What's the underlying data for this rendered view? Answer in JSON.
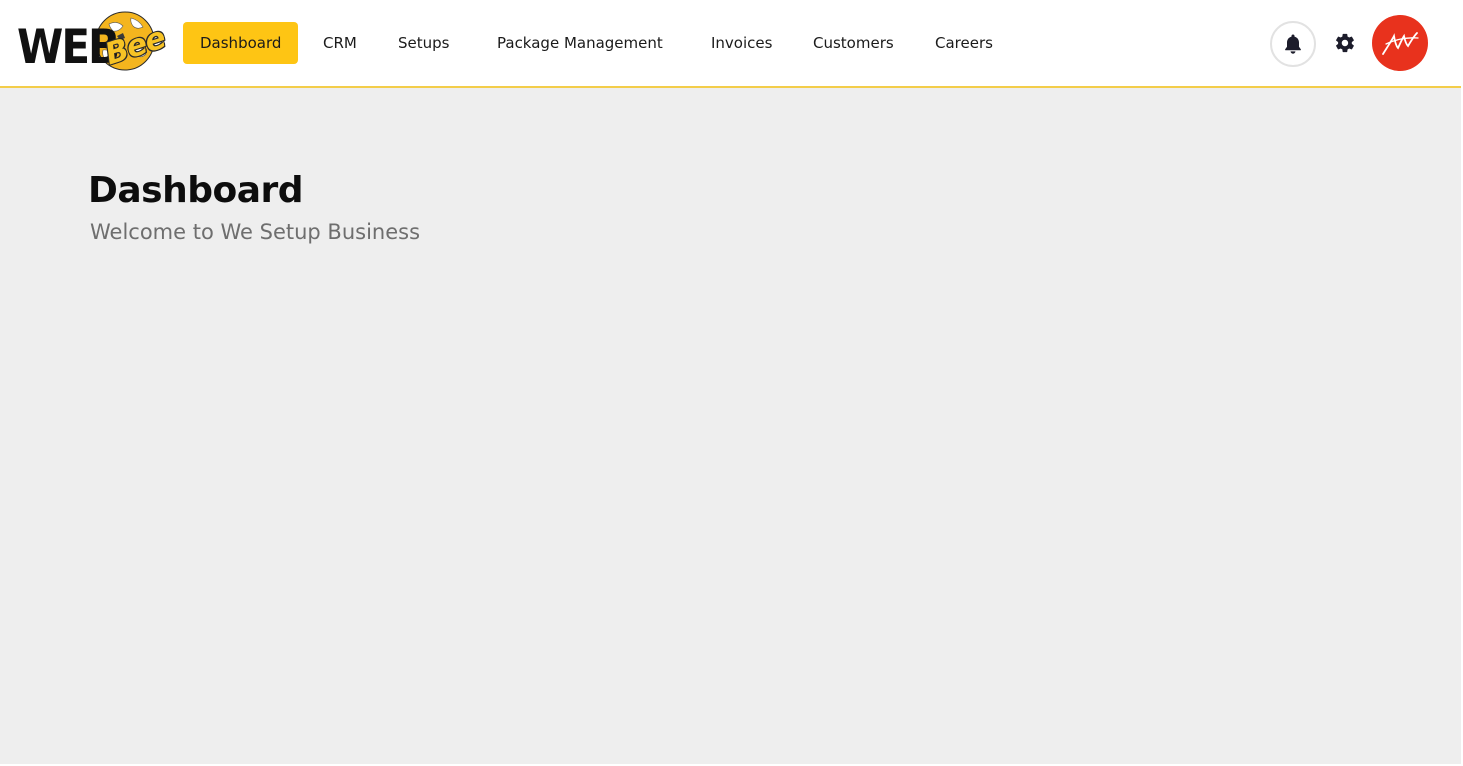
{
  "brand": {
    "logo_text": "WEB",
    "logo_accent_text": "Bee",
    "logo_colors": {
      "primary": "#111111",
      "accent": "#f7c325"
    }
  },
  "nav": {
    "items": [
      {
        "label": "Dashboard",
        "active": true
      },
      {
        "label": "CRM",
        "active": false
      },
      {
        "label": "Setups",
        "active": false
      },
      {
        "label": "Package Management",
        "active": false
      },
      {
        "label": "Invoices",
        "active": false
      },
      {
        "label": "Customers",
        "active": false
      },
      {
        "label": "Careers",
        "active": false
      }
    ],
    "active_color": "#fec514"
  },
  "header_actions": {
    "notifications_icon": "bell-icon",
    "settings_icon": "gear-icon",
    "avatar_color": "#e8321d"
  },
  "page": {
    "title": "Dashboard",
    "subtitle": "Welcome to We Setup Business"
  },
  "colors": {
    "header_border": "#f3cd4a",
    "content_background": "#eeeeee",
    "title": "#0d0d0d",
    "subtitle": "#6e6e6e"
  }
}
